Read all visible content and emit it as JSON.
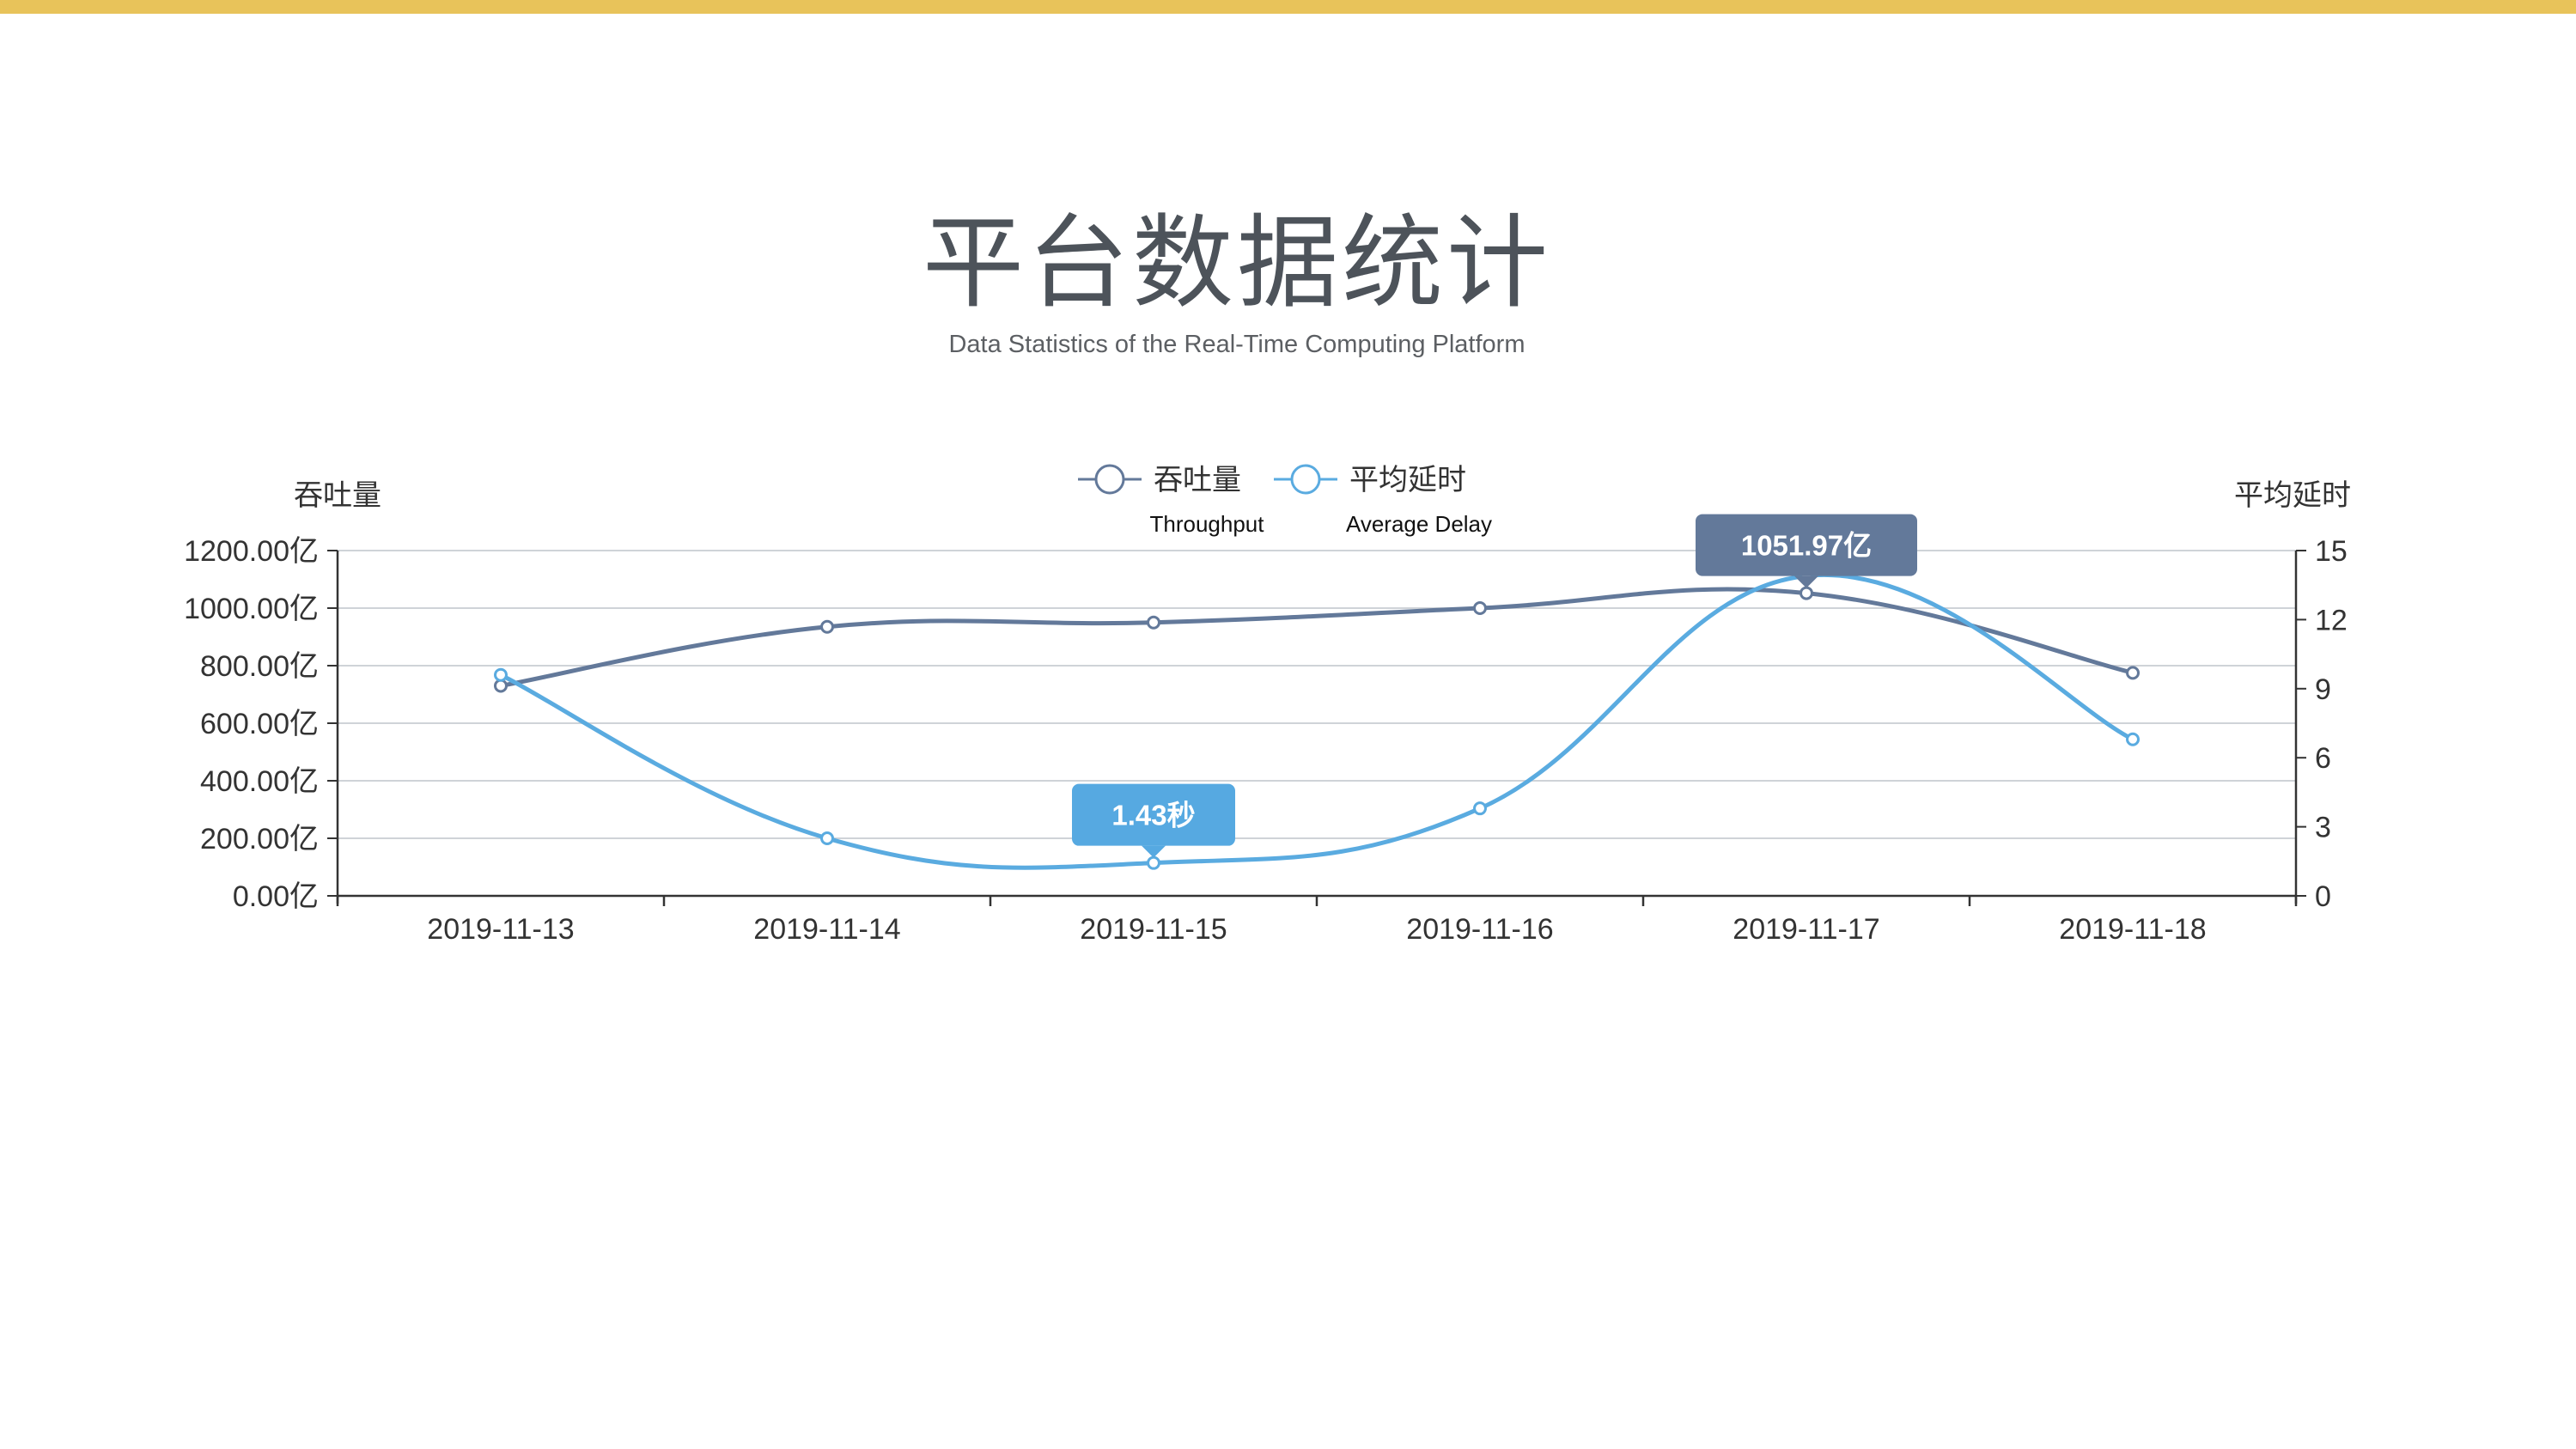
{
  "page": {
    "title": "平台数据统计",
    "subtitle": "Data Statistics of the Real-Time Computing Platform",
    "accent_color": "#e8c35a"
  },
  "chart_data": {
    "type": "line",
    "smooth": true,
    "categories": [
      "2019-11-13",
      "2019-11-14",
      "2019-11-15",
      "2019-11-16",
      "2019-11-17",
      "2019-11-18"
    ],
    "series": [
      {
        "name": "吞吐量",
        "subtitle": "Throughput",
        "axis": "left",
        "color": "#63799a",
        "values": [
          730,
          935,
          950,
          1000,
          1052,
          775
        ]
      },
      {
        "name": "平均延时",
        "subtitle": "Average Delay",
        "axis": "right",
        "color": "#5aabe0",
        "values": [
          9.6,
          2.5,
          1.43,
          3.8,
          13.9,
          6.8
        ]
      }
    ],
    "y_left": {
      "name": "吞吐量",
      "ylim": [
        0,
        1200
      ],
      "tick_labels": [
        "0.00亿",
        "200.00亿",
        "400.00亿",
        "600.00亿",
        "800.00亿",
        "1000.00亿",
        "1200.00亿"
      ]
    },
    "y_right": {
      "name": "平均延时",
      "ylim": [
        0,
        15
      ],
      "tick_labels": [
        "0",
        "3",
        "6",
        "9",
        "12",
        "15"
      ]
    },
    "grid": true,
    "legend_position": "top-center",
    "annotations": [
      {
        "series": 0,
        "category": "2019-11-17",
        "label": "1051.97亿",
        "color": "#63799a"
      },
      {
        "series": 1,
        "category": "2019-11-15",
        "label": "1.43秒",
        "color": "#56a9e1"
      }
    ]
  }
}
